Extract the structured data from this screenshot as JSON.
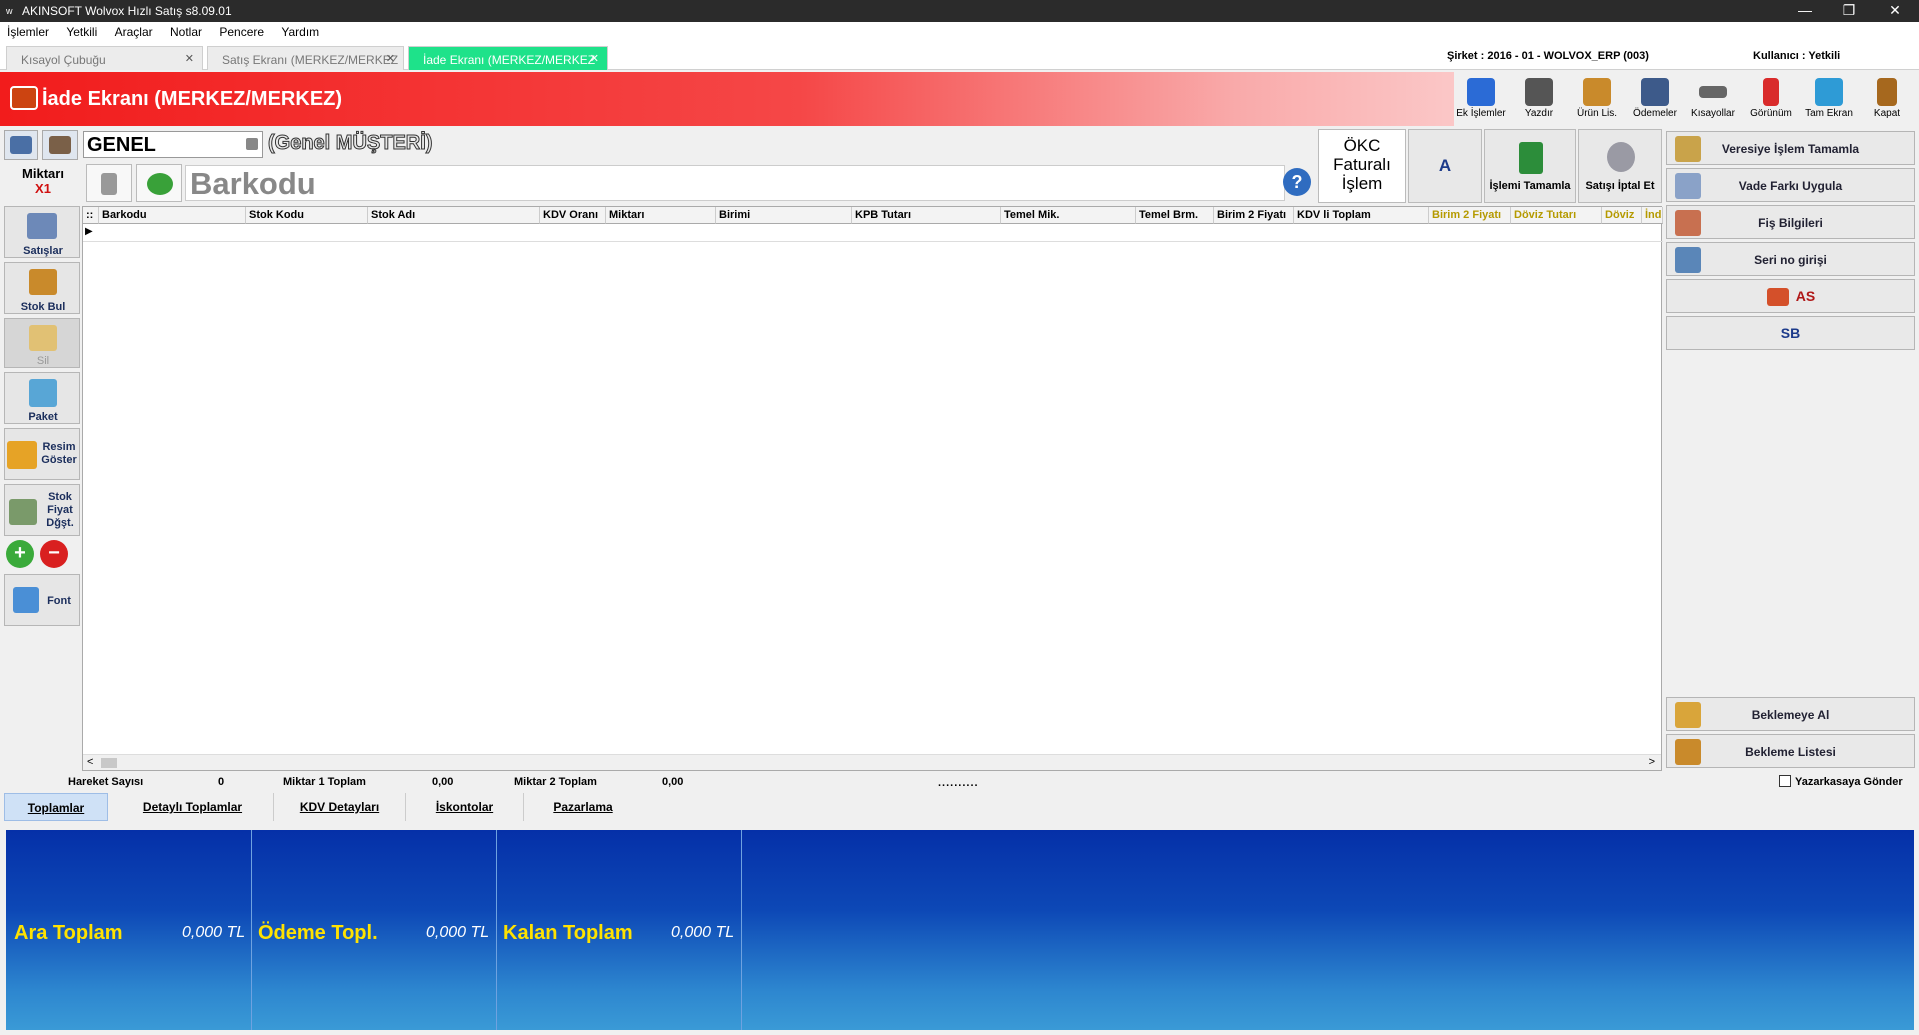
{
  "window": {
    "title": "AKINSOFT Wolvox Hızlı Satış s8.09.01",
    "logo": "w",
    "controls": {
      "minimize": "—",
      "maximize": "❐",
      "close": "✕"
    }
  },
  "menu": [
    "İşlemler",
    "Yetkili",
    "Araçlar",
    "Notlar",
    "Pencere",
    "Yardım"
  ],
  "tabs": [
    {
      "label": "Kısayol Çubuğu",
      "close": "✕"
    },
    {
      "label": "Satış Ekranı (MERKEZ/MERKEZ",
      "close": "✕"
    },
    {
      "label": "İade Ekranı (MERKEZ/MERKEZ",
      "close": "✕"
    }
  ],
  "company": "Şirket : 2016 - 01 - WOLVOX_ERP (003)",
  "user": "Kullanıcı : Yetkili",
  "header": {
    "title": "İade Ekranı (MERKEZ/MERKEZ)"
  },
  "toolbar": [
    {
      "label": "Ek İşlemler",
      "icon": "gears-icon",
      "color": "#2b6bd6"
    },
    {
      "label": "Yazdır",
      "icon": "printer-icon",
      "color": "#555555"
    },
    {
      "label": "Ürün Lis.",
      "icon": "product-list-icon",
      "color": "#c98a2b"
    },
    {
      "label": "Ödemeler",
      "icon": "payments-icon",
      "color": "#3d5a8a"
    },
    {
      "label": "Kısayollar",
      "icon": "keyboard-icon",
      "color": "#666666"
    },
    {
      "label": "Görünüm",
      "icon": "view-icon",
      "color": "#d92b2b"
    },
    {
      "label": "Tam Ekran",
      "icon": "fullscreen-icon",
      "color": "#2e9bd6"
    },
    {
      "label": "Kapat",
      "icon": "exit-door-icon",
      "color": "#a6681e"
    }
  ],
  "customer": {
    "code": "GENEL",
    "name": "(Genel MÜŞTERİ)"
  },
  "quantity": {
    "label": "Miktarı",
    "value": "X1"
  },
  "barcode_label": "Barkodu",
  "help": "?",
  "okc": {
    "line1": "ÖKC",
    "line2": "Faturalı",
    "line3": "İşlem"
  },
  "top_buttons": {
    "a": "A",
    "complete": "İşlemi Tamamla",
    "cancel": "Satışı İptal Et"
  },
  "sidebar": {
    "satislar": "Satışlar",
    "stok_bul": "Stok Bul",
    "sil": "Sil",
    "paket": "Paket",
    "resim": "Resim Göster",
    "stok_fiyat": "Stok Fiyat Dğşt.",
    "font": "Font",
    "plus": "+",
    "minus": "−"
  },
  "grid": {
    "columns": [
      "Barkodu",
      "Stok Kodu",
      "Stok Adı",
      "KDV Oranı",
      "Miktarı",
      "Birimi",
      "KPB Tutarı",
      "Temel Mik.",
      "Temel Brm.",
      "Birim 2 Fiyatı",
      "KDV li Toplam",
      "Birim 2 Fiyatı",
      "Döviz Tutarı",
      "Döviz",
      "İnd"
    ],
    "row_marker": "▶",
    "scroll_left": "<",
    "scroll_right": ">"
  },
  "right_panel": {
    "veresiye": "Veresiye İşlem Tamamla",
    "vade": "Vade Farkı Uygula",
    "fis": "Fiş Bilgileri",
    "seri": "Seri no girişi",
    "as": "AS",
    "sb": "SB",
    "beklemeye_al": "Beklemeye Al",
    "bekleme_listesi": "Bekleme Listesi"
  },
  "stats": {
    "hareket_label": "Hareket Sayısı",
    "hareket_value": "0",
    "miktar1_label": "Miktar 1 Toplam",
    "miktar1_value": "0,00",
    "miktar2_label": "Miktar 2 Toplam",
    "miktar2_value": "0,00",
    "splitter": "..........",
    "yazarkasa": "Yazarkasaya Gönder"
  },
  "bottom_tabs": [
    "Toplamlar",
    "Detaylı Toplamlar",
    "KDV Detayları",
    "İskontolar",
    "Pazarlama"
  ],
  "totals": [
    {
      "label": "Ara Toplam",
      "value": "0,000 TL"
    },
    {
      "label": "Ödeme Topl.",
      "value": "0,000 TL"
    },
    {
      "label": "Kalan Toplam",
      "value": "0,000 TL"
    }
  ]
}
